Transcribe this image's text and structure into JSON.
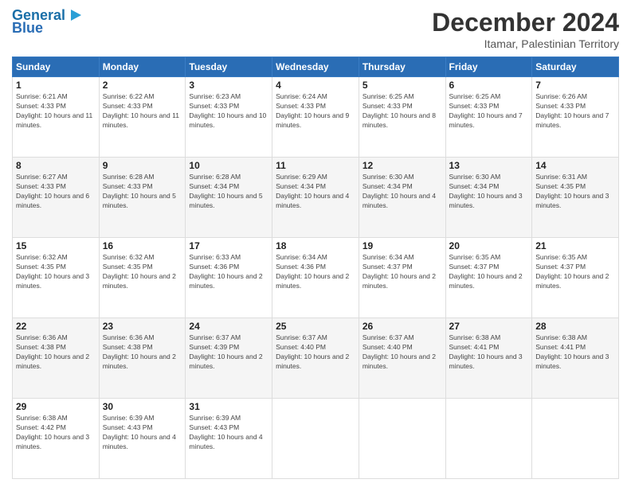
{
  "logo": {
    "line1": "General",
    "line2": "Blue"
  },
  "header": {
    "month": "December 2024",
    "location": "Itamar, Palestinian Territory"
  },
  "days_of_week": [
    "Sunday",
    "Monday",
    "Tuesday",
    "Wednesday",
    "Thursday",
    "Friday",
    "Saturday"
  ],
  "weeks": [
    [
      {
        "day": "1",
        "sunrise": "6:21 AM",
        "sunset": "4:33 PM",
        "daylight": "10 hours and 11 minutes."
      },
      {
        "day": "2",
        "sunrise": "6:22 AM",
        "sunset": "4:33 PM",
        "daylight": "10 hours and 11 minutes."
      },
      {
        "day": "3",
        "sunrise": "6:23 AM",
        "sunset": "4:33 PM",
        "daylight": "10 hours and 10 minutes."
      },
      {
        "day": "4",
        "sunrise": "6:24 AM",
        "sunset": "4:33 PM",
        "daylight": "10 hours and 9 minutes."
      },
      {
        "day": "5",
        "sunrise": "6:25 AM",
        "sunset": "4:33 PM",
        "daylight": "10 hours and 8 minutes."
      },
      {
        "day": "6",
        "sunrise": "6:25 AM",
        "sunset": "4:33 PM",
        "daylight": "10 hours and 7 minutes."
      },
      {
        "day": "7",
        "sunrise": "6:26 AM",
        "sunset": "4:33 PM",
        "daylight": "10 hours and 7 minutes."
      }
    ],
    [
      {
        "day": "8",
        "sunrise": "6:27 AM",
        "sunset": "4:33 PM",
        "daylight": "10 hours and 6 minutes."
      },
      {
        "day": "9",
        "sunrise": "6:28 AM",
        "sunset": "4:33 PM",
        "daylight": "10 hours and 5 minutes."
      },
      {
        "day": "10",
        "sunrise": "6:28 AM",
        "sunset": "4:34 PM",
        "daylight": "10 hours and 5 minutes."
      },
      {
        "day": "11",
        "sunrise": "6:29 AM",
        "sunset": "4:34 PM",
        "daylight": "10 hours and 4 minutes."
      },
      {
        "day": "12",
        "sunrise": "6:30 AM",
        "sunset": "4:34 PM",
        "daylight": "10 hours and 4 minutes."
      },
      {
        "day": "13",
        "sunrise": "6:30 AM",
        "sunset": "4:34 PM",
        "daylight": "10 hours and 3 minutes."
      },
      {
        "day": "14",
        "sunrise": "6:31 AM",
        "sunset": "4:35 PM",
        "daylight": "10 hours and 3 minutes."
      }
    ],
    [
      {
        "day": "15",
        "sunrise": "6:32 AM",
        "sunset": "4:35 PM",
        "daylight": "10 hours and 3 minutes."
      },
      {
        "day": "16",
        "sunrise": "6:32 AM",
        "sunset": "4:35 PM",
        "daylight": "10 hours and 2 minutes."
      },
      {
        "day": "17",
        "sunrise": "6:33 AM",
        "sunset": "4:36 PM",
        "daylight": "10 hours and 2 minutes."
      },
      {
        "day": "18",
        "sunrise": "6:34 AM",
        "sunset": "4:36 PM",
        "daylight": "10 hours and 2 minutes."
      },
      {
        "day": "19",
        "sunrise": "6:34 AM",
        "sunset": "4:37 PM",
        "daylight": "10 hours and 2 minutes."
      },
      {
        "day": "20",
        "sunrise": "6:35 AM",
        "sunset": "4:37 PM",
        "daylight": "10 hours and 2 minutes."
      },
      {
        "day": "21",
        "sunrise": "6:35 AM",
        "sunset": "4:37 PM",
        "daylight": "10 hours and 2 minutes."
      }
    ],
    [
      {
        "day": "22",
        "sunrise": "6:36 AM",
        "sunset": "4:38 PM",
        "daylight": "10 hours and 2 minutes."
      },
      {
        "day": "23",
        "sunrise": "6:36 AM",
        "sunset": "4:38 PM",
        "daylight": "10 hours and 2 minutes."
      },
      {
        "day": "24",
        "sunrise": "6:37 AM",
        "sunset": "4:39 PM",
        "daylight": "10 hours and 2 minutes."
      },
      {
        "day": "25",
        "sunrise": "6:37 AM",
        "sunset": "4:40 PM",
        "daylight": "10 hours and 2 minutes."
      },
      {
        "day": "26",
        "sunrise": "6:37 AM",
        "sunset": "4:40 PM",
        "daylight": "10 hours and 2 minutes."
      },
      {
        "day": "27",
        "sunrise": "6:38 AM",
        "sunset": "4:41 PM",
        "daylight": "10 hours and 3 minutes."
      },
      {
        "day": "28",
        "sunrise": "6:38 AM",
        "sunset": "4:41 PM",
        "daylight": "10 hours and 3 minutes."
      }
    ],
    [
      {
        "day": "29",
        "sunrise": "6:38 AM",
        "sunset": "4:42 PM",
        "daylight": "10 hours and 3 minutes."
      },
      {
        "day": "30",
        "sunrise": "6:39 AM",
        "sunset": "4:43 PM",
        "daylight": "10 hours and 4 minutes."
      },
      {
        "day": "31",
        "sunrise": "6:39 AM",
        "sunset": "4:43 PM",
        "daylight": "10 hours and 4 minutes."
      },
      null,
      null,
      null,
      null
    ]
  ]
}
